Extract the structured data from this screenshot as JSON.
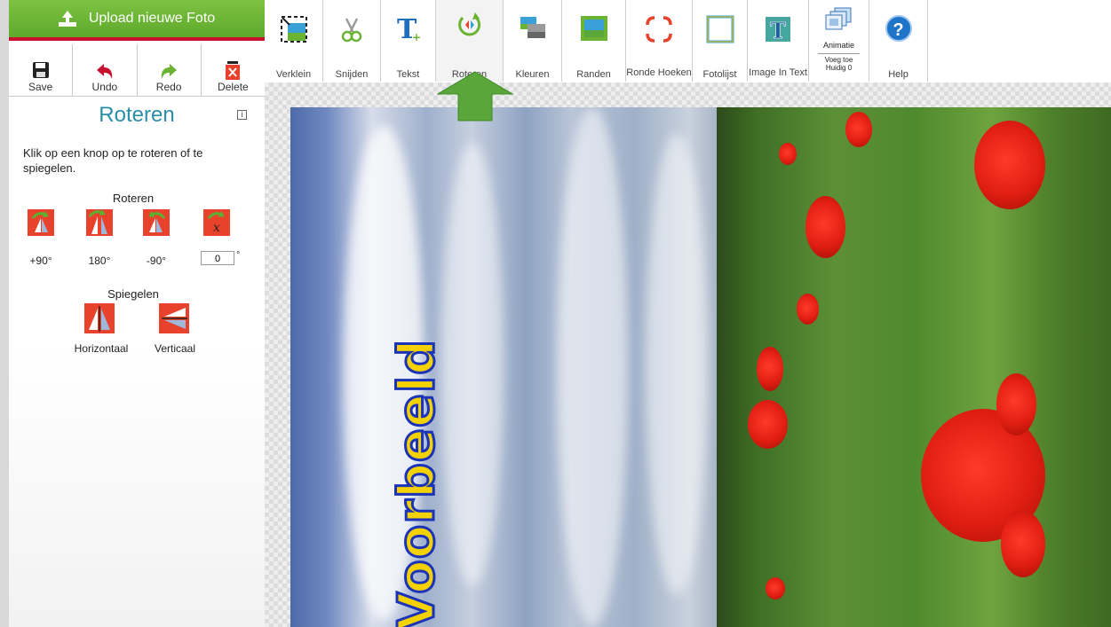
{
  "left_panel": {
    "upload_label": "Upload nieuwe Foto",
    "actions": [
      {
        "label": "Save",
        "icon": "save-icon"
      },
      {
        "label": "Undo",
        "icon": "undo-icon"
      },
      {
        "label": "Redo",
        "icon": "redo-icon"
      },
      {
        "label": "Delete",
        "icon": "delete-icon"
      }
    ],
    "title": "Roteren",
    "info_glyph": "i",
    "intro": "Klik op een knop op te roteren of te spiegelen.",
    "rotate_section": "Roteren",
    "rotate_buttons": [
      {
        "label": "+90°"
      },
      {
        "label": "180°"
      },
      {
        "label": "-90°"
      }
    ],
    "custom_angle_value": "0",
    "degree_symbol": "°",
    "mirror_section": "Spiegelen",
    "mirror_buttons": [
      {
        "label": "Horizontaal"
      },
      {
        "label": "Verticaal"
      }
    ]
  },
  "toolbar": {
    "tools": [
      {
        "label": "Verklein",
        "icon": "resize-icon"
      },
      {
        "label": "Snijden",
        "icon": "scissors-icon"
      },
      {
        "label": "Tekst",
        "icon": "text-icon"
      },
      {
        "label": "Roteren",
        "icon": "rotate-icon"
      },
      {
        "label": "Kleuren",
        "icon": "colors-icon"
      },
      {
        "label": "Randen",
        "icon": "borders-icon"
      },
      {
        "label": "Ronde Hoeken",
        "icon": "rounded-corners-icon"
      },
      {
        "label": "Fotolijst",
        "icon": "photo-frame-icon"
      },
      {
        "label": "Image In Text",
        "icon": "image-in-text-icon"
      },
      {
        "label": "Help",
        "icon": "help-icon"
      }
    ],
    "animatie": {
      "title": "Animatie",
      "line1": "Voeg toe",
      "line2": "Huidig 0",
      "icon": "animation-icon"
    },
    "help_glyph": "?"
  },
  "image": {
    "overlay_text": "Voorbeeld"
  },
  "colors": {
    "accent": "#2a8fa8",
    "upload_green": "#6bb332",
    "button_red": "#e8412c",
    "arrow_green": "#5aa63a"
  }
}
